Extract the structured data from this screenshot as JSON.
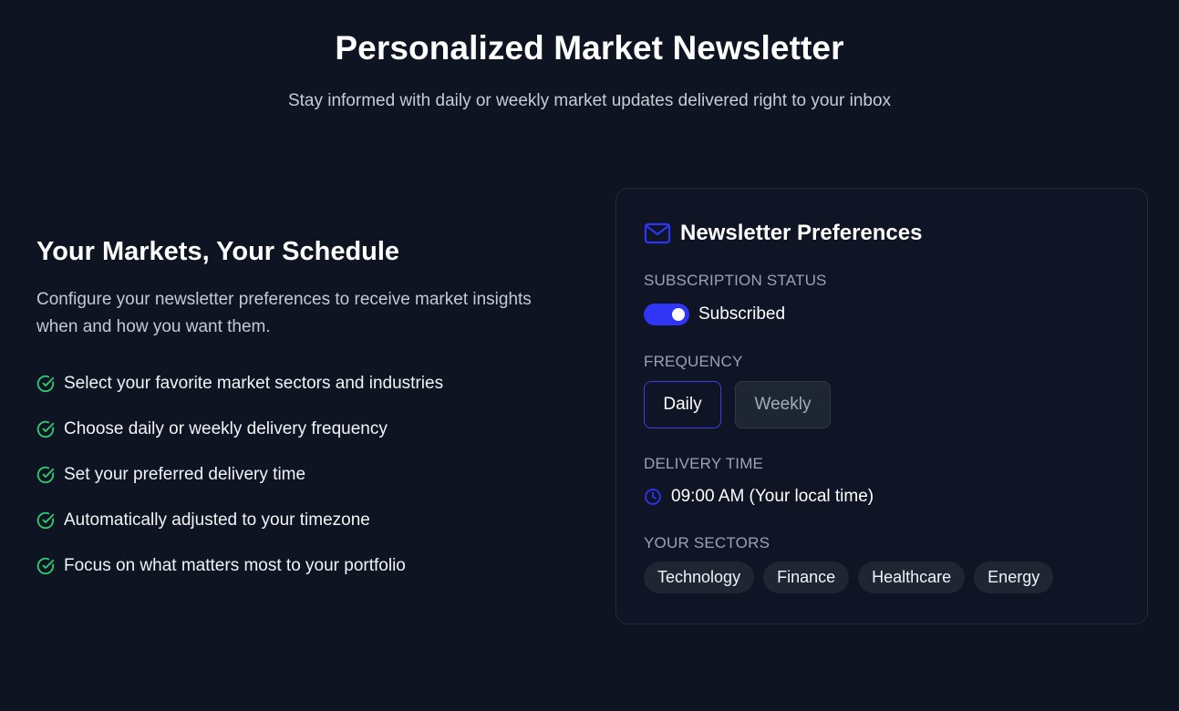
{
  "hero": {
    "title": "Personalized Market Newsletter",
    "subtitle": "Stay informed with daily or weekly market updates delivered right to your inbox"
  },
  "intro": {
    "title": "Your Markets, Your Schedule",
    "description": "Configure your newsletter preferences to receive market insights when and how you want them.",
    "features": [
      "Select your favorite market sectors and industries",
      "Choose daily or weekly delivery frequency",
      "Set your preferred delivery time",
      "Automatically adjusted to your timezone",
      "Focus on what matters most to your portfolio"
    ]
  },
  "preferences": {
    "title": "Newsletter Preferences",
    "subscription_label": "SUBSCRIPTION STATUS",
    "subscription_status": "Subscribed",
    "subscribed": true,
    "frequency_label": "FREQUENCY",
    "frequency_options": [
      "Daily",
      "Weekly"
    ],
    "frequency_selected": "Daily",
    "delivery_label": "DELIVERY TIME",
    "delivery_time": "09:00 AM (Your local time)",
    "sectors_label": "YOUR SECTORS",
    "sectors": [
      "Technology",
      "Finance",
      "Healthcare",
      "Energy"
    ]
  },
  "icons": {
    "feature": "check-circle-icon",
    "header": "mail-icon",
    "time": "clock-icon"
  },
  "colors": {
    "background": "#0e1422",
    "accent": "#2f35f5",
    "check": "#2ecc71",
    "muted_text": "#9aa3b2"
  }
}
